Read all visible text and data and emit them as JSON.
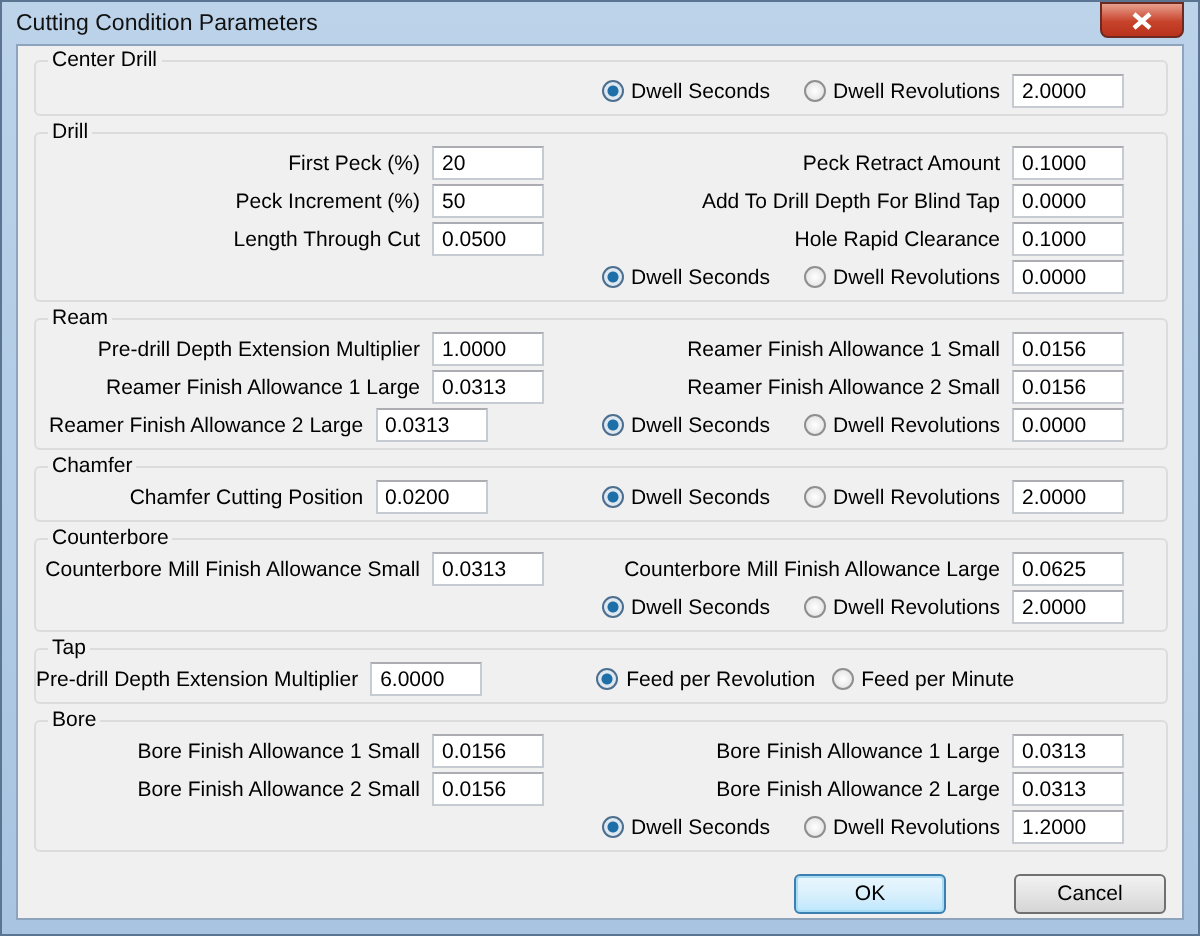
{
  "window": {
    "title": "Cutting Condition Parameters"
  },
  "groups": [
    {
      "title": "Center Drill",
      "rows": [
        {
          "right": {
            "kind": "radios",
            "options": [
              {
                "label": "Dwell Seconds",
                "selected": true
              },
              {
                "label": "Dwell Revolutions",
                "selected": false
              }
            ],
            "value": "2.0000"
          }
        }
      ]
    },
    {
      "title": "Drill",
      "rows": [
        {
          "left": {
            "label": "First Peck (%)",
            "value": "20"
          },
          "right": {
            "kind": "field",
            "label": "Peck Retract Amount",
            "value": "0.1000"
          }
        },
        {
          "left": {
            "label": "Peck Increment (%)",
            "value": "50"
          },
          "right": {
            "kind": "field",
            "label": "Add To Drill Depth For Blind Tap",
            "value": "0.0000"
          }
        },
        {
          "left": {
            "label": "Length Through Cut",
            "value": "0.0500"
          },
          "right": {
            "kind": "field",
            "label": "Hole Rapid Clearance",
            "value": "0.1000"
          }
        },
        {
          "right": {
            "kind": "radios",
            "options": [
              {
                "label": "Dwell Seconds",
                "selected": true
              },
              {
                "label": "Dwell Revolutions",
                "selected": false
              }
            ],
            "value": "0.0000"
          }
        }
      ]
    },
    {
      "title": "Ream",
      "rows": [
        {
          "left": {
            "label": "Pre-drill Depth Extension Multiplier",
            "value": "1.0000"
          },
          "right": {
            "kind": "field",
            "label": "Reamer Finish Allowance 1 Small",
            "value": "0.0156"
          }
        },
        {
          "left": {
            "label": "Reamer Finish Allowance 1 Large",
            "value": "0.0313"
          },
          "right": {
            "kind": "field",
            "label": "Reamer Finish Allowance 2 Small",
            "value": "0.0156"
          }
        },
        {
          "left": {
            "label": "Reamer Finish Allowance 2 Large",
            "value": "0.0313"
          },
          "right": {
            "kind": "radios",
            "options": [
              {
                "label": "Dwell Seconds",
                "selected": true
              },
              {
                "label": "Dwell Revolutions",
                "selected": false
              }
            ],
            "value": "0.0000"
          }
        }
      ]
    },
    {
      "title": "Chamfer",
      "rows": [
        {
          "left": {
            "label": "Chamfer Cutting Position",
            "value": "0.0200"
          },
          "right": {
            "kind": "radios",
            "options": [
              {
                "label": "Dwell Seconds",
                "selected": true
              },
              {
                "label": "Dwell Revolutions",
                "selected": false
              }
            ],
            "value": "2.0000"
          }
        }
      ]
    },
    {
      "title": "Counterbore",
      "rows": [
        {
          "left": {
            "label": "Counterbore Mill Finish Allowance Small",
            "value": "0.0313"
          },
          "right": {
            "kind": "field",
            "label": "Counterbore Mill Finish Allowance Large",
            "value": "0.0625"
          }
        },
        {
          "right": {
            "kind": "radios",
            "options": [
              {
                "label": "Dwell Seconds",
                "selected": true
              },
              {
                "label": "Dwell Revolutions",
                "selected": false
              }
            ],
            "value": "2.0000"
          }
        }
      ]
    },
    {
      "title": "Tap",
      "rows": [
        {
          "left": {
            "label": "Pre-drill Depth Extension Multiplier",
            "value": "6.0000"
          },
          "right": {
            "kind": "radios",
            "options": [
              {
                "label": "Feed per Revolution",
                "selected": true
              },
              {
                "label": "Feed per Minute",
                "selected": false
              }
            ]
          }
        }
      ]
    },
    {
      "title": "Bore",
      "rows": [
        {
          "left": {
            "label": "Bore Finish Allowance 1 Small",
            "value": "0.0156"
          },
          "right": {
            "kind": "field",
            "label": "Bore Finish Allowance 1 Large",
            "value": "0.0313"
          }
        },
        {
          "left": {
            "label": "Bore Finish Allowance 2 Small",
            "value": "0.0156"
          },
          "right": {
            "kind": "field",
            "label": "Bore Finish Allowance 2 Large",
            "value": "0.0313"
          }
        },
        {
          "right": {
            "kind": "radios",
            "options": [
              {
                "label": "Dwell Seconds",
                "selected": true
              },
              {
                "label": "Dwell Revolutions",
                "selected": false
              }
            ],
            "value": "1.2000"
          }
        }
      ]
    }
  ],
  "buttons": [
    {
      "label": "OK",
      "default": true
    },
    {
      "label": "Cancel",
      "default": false
    }
  ]
}
